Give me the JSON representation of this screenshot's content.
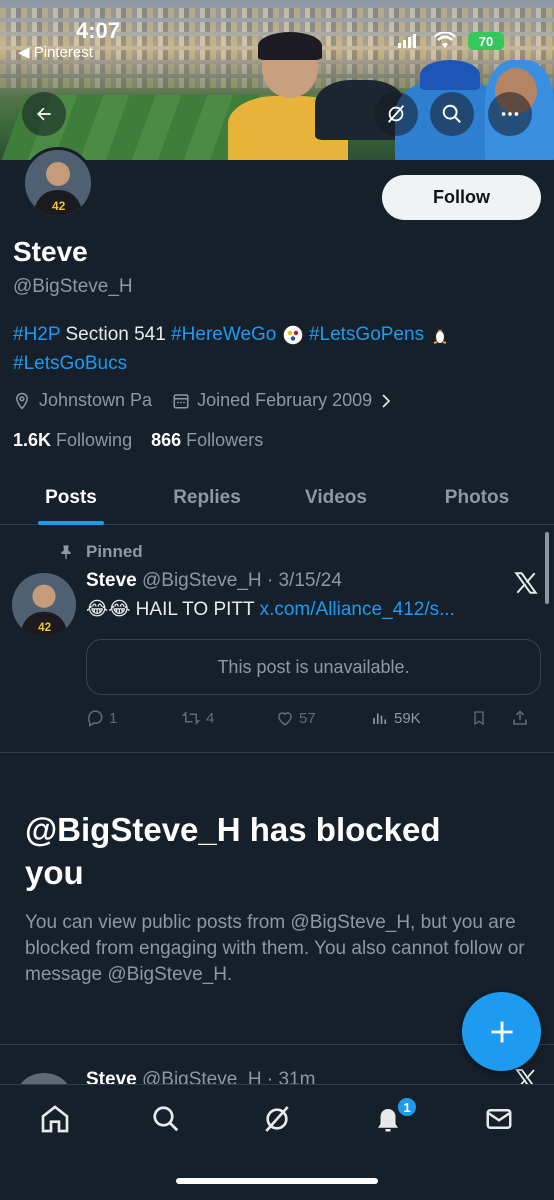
{
  "status_bar": {
    "time": "4:07",
    "back_app": "◀ Pinterest",
    "battery": "70"
  },
  "profile": {
    "name": "Steve",
    "handle": "@BigSteve_H",
    "follow_label": "Follow",
    "bio": {
      "tag1": "#H2P",
      "text1": " Section 541 ",
      "tag2": "#HereWeGo",
      "tag3": "#LetsGoPens",
      "tag4": "#LetsGoBucs"
    },
    "location": "Johnstown Pa",
    "joined": "Joined February 2009",
    "following_count": "1.6K",
    "following_label": "Following",
    "followers_count": "866",
    "followers_label": "Followers"
  },
  "tabs": [
    {
      "label": "Posts",
      "active": true
    },
    {
      "label": "Replies",
      "active": false
    },
    {
      "label": "Videos",
      "active": false
    },
    {
      "label": "Photos",
      "active": false
    }
  ],
  "pinned_post": {
    "pinned_label": "Pinned",
    "author": "Steve",
    "handle_date": "@BigSteve_H · 3/15/24",
    "emoji": "😂😂",
    "text": " HAIL TO PITT ",
    "link": "x.com/Alliance_412/s...",
    "unavailable": "This post is unavailable.",
    "replies": "1",
    "reposts": "4",
    "likes": "57",
    "views": "59K"
  },
  "blocked": {
    "title": "@BigSteve_H has blocked you",
    "body": "You can view public posts from @BigSteve_H, but you are blocked from engaging with them. You also cannot follow or message @BigSteve_H."
  },
  "next_post": {
    "author": "Steve",
    "handle_date": "@BigSteve_H · 31m"
  },
  "bottom_nav": {
    "notification_count": "1"
  },
  "colors": {
    "background": "#15202b",
    "accent": "#1d9bf0",
    "muted_text": "#8b98a5"
  }
}
